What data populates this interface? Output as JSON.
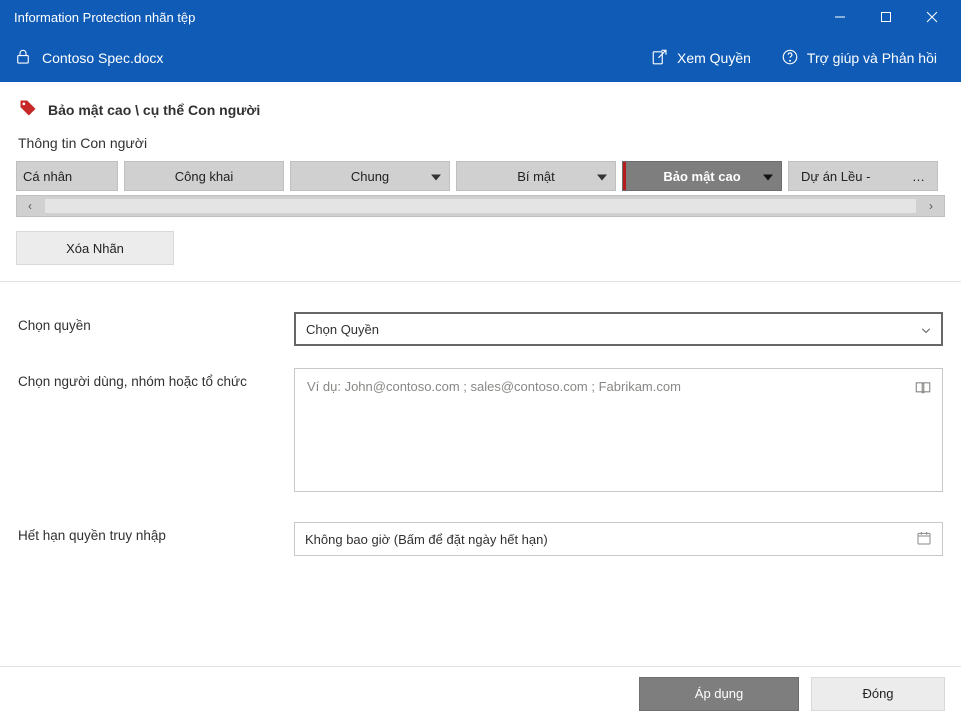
{
  "window": {
    "title": "Information Protection nhãn tệp"
  },
  "toolbar": {
    "filename": "Contoso Spec.docx",
    "view_permissions": "Xem Quyền",
    "help_feedback": "Trợ giúp và Phản hồi"
  },
  "label_strip": {
    "text": "Bảo mật cao \\ cụ thể Con người"
  },
  "section_heading": "Thông tin Con người",
  "tabs": {
    "personal": "Cá nhân",
    "public": "Công khai",
    "general": "Chung",
    "confidential": "Bí mật",
    "highly": "Bảo mật cao",
    "project": "Dự án Lều -",
    "ellipsis": "…"
  },
  "delete_label_btn": "Xóa Nhãn",
  "form": {
    "choose_permissions_label": "Chọn quyền",
    "choose_permissions_value": "Chọn Quyền",
    "choose_users_label": "Chọn người dùng, nhóm hoặc tổ chức",
    "choose_users_placeholder": "Ví dụ: John@contoso.com ; sales@contoso.com ; Fabrikam.com",
    "expire_label": "Hết hạn quyền truy nhập",
    "expire_value": "Không bao giờ (Bấm để đặt ngày hết hạn)"
  },
  "footer": {
    "apply": "Áp dụng",
    "close": "Đóng"
  }
}
